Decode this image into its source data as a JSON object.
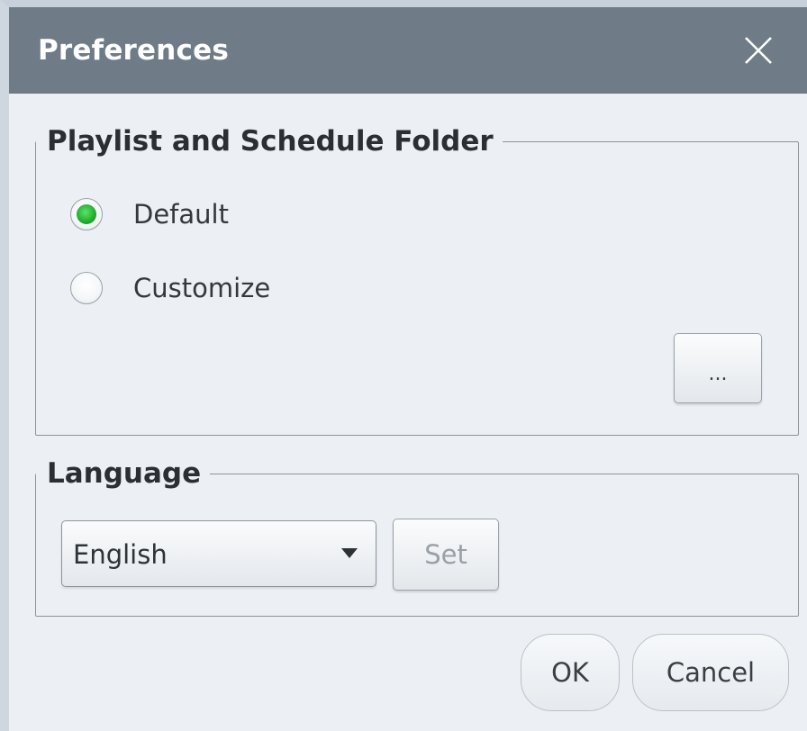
{
  "window": {
    "title": "Preferences",
    "close_icon": "close-icon"
  },
  "folder_group": {
    "legend": "Playlist and Schedule Folder",
    "options": [
      {
        "label": "Default",
        "selected": true
      },
      {
        "label": "Customize",
        "selected": false
      }
    ],
    "browse_label": "..."
  },
  "language_group": {
    "legend": "Language",
    "selected_language": "English",
    "set_label": "Set"
  },
  "footer": {
    "ok_label": "OK",
    "cancel_label": "Cancel"
  },
  "colors": {
    "titlebar": "#6f7c87",
    "background": "#ecf0f5",
    "radio_selected": "#1fae2c"
  }
}
